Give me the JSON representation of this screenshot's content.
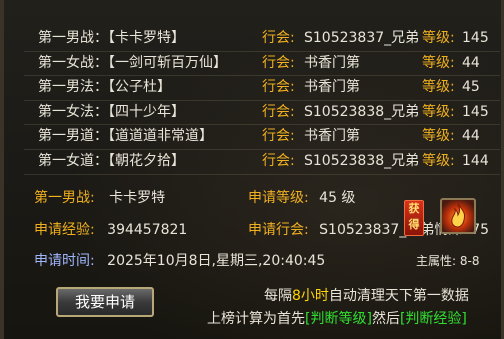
{
  "rankings": [
    {
      "label": "第一男战：【卡卡罗特】",
      "guild_label": "行会:",
      "guild": "S10523837_兄弟",
      "level_label": "等级:",
      "level": "145"
    },
    {
      "label": "第一女战：【一剑可斩百万仙】",
      "guild_label": "行会:",
      "guild": "书香门第",
      "level_label": "等级:",
      "level": "44"
    },
    {
      "label": "第一男法：【公子杜】",
      "guild_label": "行会:",
      "guild": "书香门第",
      "level_label": "等级:",
      "level": "45"
    },
    {
      "label": "第一女法：【四十少年】",
      "guild_label": "行会:",
      "guild": "S10523838_兄弟",
      "level_label": "等级:",
      "level": "145"
    },
    {
      "label": "第一男道：【道道道非常道】",
      "guild_label": "行会:",
      "guild": "书香门第",
      "level_label": "等级:",
      "level": "44"
    },
    {
      "label": "第一女道：【朝花夕拾】",
      "guild_label": "行会:",
      "guild": "S10523838_兄弟",
      "level_label": "等级:",
      "level": "144"
    }
  ],
  "detail": {
    "title_label": "第一男战:",
    "title_value": "卡卡罗特",
    "apply_level_label": "申请等级:",
    "apply_level_value": "45 级",
    "apply_exp_label": "申请经验:",
    "apply_exp_value": "394457821",
    "apply_guild_label": "申请行会:",
    "apply_guild_value": "S10523837_兄弟情深175",
    "apply_time_label": "申请时间:",
    "apply_time_value": "2025年10月8日,星期三,20:40:45"
  },
  "badge_text": "获得",
  "main_attr": "主属性: 8-8",
  "apply_button": "我要申请",
  "notice": {
    "line1_a": "每隔",
    "line1_hl": "8小时",
    "line1_b": "自动清理天下第一数据",
    "line2_a": "上榜计算为首先",
    "line2_hl1": "[判断等级]",
    "line2_b": "然后",
    "line2_hl2": "[判断经验]"
  },
  "colors": {
    "label_gold": "#f0b020",
    "text": "#e8e4d8",
    "time_label": "#9fb6ff",
    "highlight_yellow": "#ffd400",
    "highlight_green": "#30e030"
  },
  "icons": [
    "fire-attribute-icon"
  ]
}
